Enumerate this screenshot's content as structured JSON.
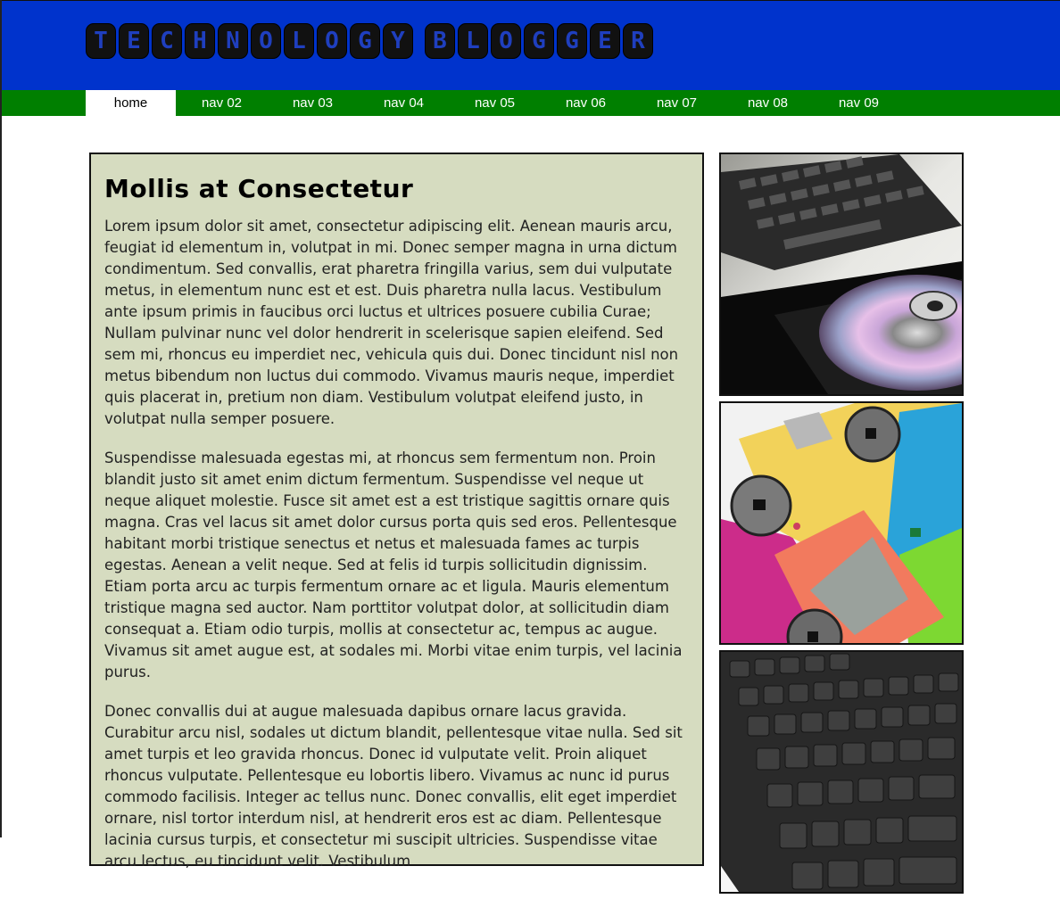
{
  "site": {
    "title": "TECHNOLOGY BLOGGER",
    "logo_words": [
      [
        "T",
        "E",
        "C",
        "H",
        "N",
        "O",
        "L",
        "O",
        "G",
        "Y"
      ],
      [
        "B",
        "L",
        "O",
        "G",
        "G",
        "E",
        "R"
      ]
    ]
  },
  "nav": {
    "items": [
      {
        "label": "home",
        "active": true
      },
      {
        "label": "nav 02",
        "active": false
      },
      {
        "label": "nav 03",
        "active": false
      },
      {
        "label": "nav 04",
        "active": false
      },
      {
        "label": "nav 05",
        "active": false
      },
      {
        "label": "nav 06",
        "active": false
      },
      {
        "label": "nav 07",
        "active": false
      },
      {
        "label": "nav 08",
        "active": false
      },
      {
        "label": "nav 09",
        "active": false
      }
    ]
  },
  "article": {
    "title": "Mollis at Consectetur",
    "paragraphs": [
      "Lorem ipsum dolor sit amet, consectetur adipiscing elit. Aenean mauris arcu, feugiat id elementum in, volutpat in mi. Donec semper magna in urna dictum condimentum. Sed convallis, erat pharetra fringilla varius, sem dui vulputate metus, in elementum nunc est et est. Duis pharetra nulla lacus. Vestibulum ante ipsum primis in faucibus orci luctus et ultrices posuere cubilia Curae; Nullam pulvinar nunc vel dolor hendrerit in scelerisque sapien eleifend. Sed sem mi, rhoncus eu imperdiet nec, vehicula quis dui. Donec tincidunt nisl non metus bibendum non luctus dui commodo. Vivamus mauris neque, imperdiet quis placerat in, pretium non diam. Vestibulum volutpat eleifend justo, in volutpat nulla semper posuere.",
      "Suspendisse malesuada egestas mi, at rhoncus sem fermentum non. Proin blandit justo sit amet enim dictum fermentum. Suspendisse vel neque ut neque aliquet molestie. Fusce sit amet est a est tristique sagittis ornare quis magna. Cras vel lacus sit amet dolor cursus porta quis sed eros. Pellentesque habitant morbi tristique senectus et netus et malesuada fames ac turpis egestas. Aenean a velit neque. Sed at felis id turpis sollicitudin dignissim. Etiam porta arcu ac turpis fermentum ornare ac et ligula. Mauris elementum tristique magna sed auctor. Nam porttitor volutpat dolor, at sollicitudin diam consequat a. Etiam odio turpis, mollis at consectetur ac, tempus ac augue. Vivamus sit amet augue est, at sodales mi. Morbi vitae enim turpis, vel lacinia purus.",
      "Donec convallis dui at augue malesuada dapibus ornare lacus gravida. Curabitur arcu nisl, sodales ut dictum blandit, pellentesque vitae nulla. Sed sit amet turpis et leo gravida rhoncus. Donec id vulputate velit. Proin aliquet rhoncus vulputate. Pellentesque eu lobortis libero. Vivamus ac nunc id purus commodo facilisis. Integer ac tellus nunc. Donec convallis, elit eget imperdiet ornare, nisl tortor interdum nisl, at hendrerit eros est ac diam. Pellentesque lacinia cursus turpis, et consectetur mi suscipit ultricies. Suspendisse vitae arcu lectus, eu tincidunt velit. Vestibulum"
    ]
  },
  "colors": {
    "header_bg": "#0033cc",
    "nav_bg": "#007f00",
    "content_bg": "#d6dcc0"
  }
}
